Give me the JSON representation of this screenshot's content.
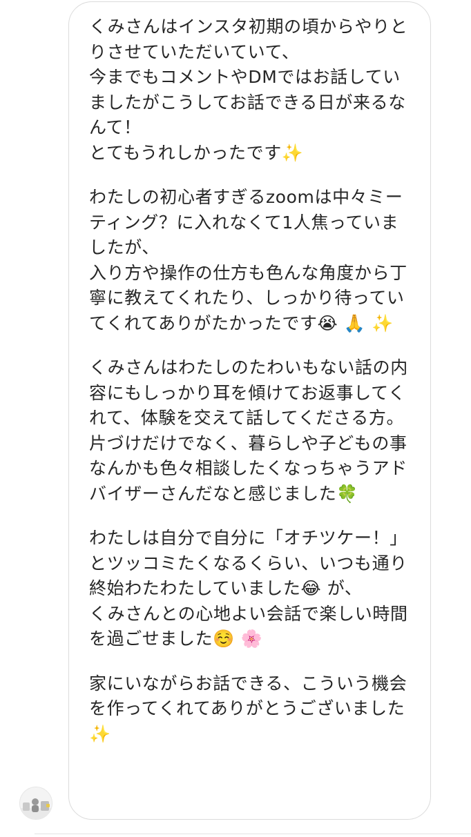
{
  "message": {
    "paragraphs": [
      {
        "lines": [
          "くみさんはインスタ初期の頃からやりと",
          "りさせていただいていて、",
          "今までもコメントやDMではお話してい",
          "ましたがこうしてお話できる日が来るな",
          "んて！",
          "とてもうれしかったです✨"
        ]
      },
      {
        "lines": [
          "わたしの初心者すぎるzoomは中々ミー",
          "ティング？に入れなくて1人焦っていま",
          "したが、",
          "入り方や操作の仕方も色んな角度から丁",
          "寧に教えてくれたり、しっかり待ってい",
          "てくれてありがたかったです😭 🙏 ✨"
        ]
      },
      {
        "lines": [
          "くみさんはわたしのたわいもない話の内",
          "容にもしっかり耳を傾けてお返事してく",
          "れて、体験を交えて話してくださる方。",
          "片づけだけでなく、暮らしや子どもの事",
          "なんかも色々相談したくなっちゃうアド",
          "バイザーさんだなと感じました🍀"
        ]
      },
      {
        "lines": [
          "わたしは自分で自分に「オチツケー！」",
          "とツッコミたくなるくらい、いつも通り",
          "終始わたわたしていました😂 が、",
          "くみさんとの心地よい会話で楽しい時間",
          "を過ごせました☺️ 🌸"
        ]
      },
      {
        "lines": [
          "家にいながらお話できる、こういう機会",
          "を作ってくれてありがとうございました",
          "✨"
        ]
      }
    ]
  },
  "avatar": {
    "icon": "sender-avatar",
    "colors": {
      "background": "#f2f2f2",
      "figure": "#9a9a9a",
      "accent": "#e8c94a"
    }
  }
}
